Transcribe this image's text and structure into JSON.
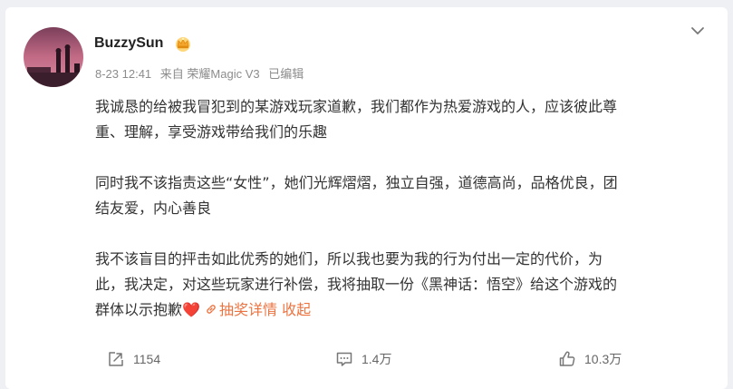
{
  "post": {
    "username": "BuzzySun",
    "badge_icon": "crown-badge-icon",
    "meta": {
      "time": "8-23 12:41",
      "source": "来自 荣耀Magic V3",
      "edited": "已编辑"
    },
    "paragraphs": {
      "p1_line1": "我诚恳的给被我冒犯到的某游戏玩家道歉，我们都作为热爱游戏的人，应该彼此尊",
      "p1_line2": "重、理解，享受游戏带给我们的乐趣",
      "p2_line1": "同时我不该指责这些“女性”，她们光辉熠熠，独立自强，道德高尚，品格优良，团",
      "p2_line2": "结友爱，内心善良",
      "p3_line1": "我不该盲目的抨击如此优秀的她们，所以我也要为我的行为付出一定的代价，为",
      "p3_line2": "此，我决定，对这些玩家进行补偿，我将抽取一份《黑神话：悟空》给这个游戏的",
      "p3_line3_prefix": "群体以示抱歉",
      "p3_heart": "❤️"
    },
    "lottery_link": "抽奖详情",
    "collapse_link": "收起"
  },
  "actions": {
    "repost": {
      "icon": "repost-icon",
      "count": "1154"
    },
    "comment": {
      "icon": "comment-icon",
      "count": "1.4万"
    },
    "like": {
      "icon": "thumbs-up-icon",
      "count": "10.3万"
    }
  },
  "colors": {
    "link": "#eb7340",
    "meta": "#8c8c8c",
    "text": "#333333",
    "background": "#eef0f4"
  }
}
